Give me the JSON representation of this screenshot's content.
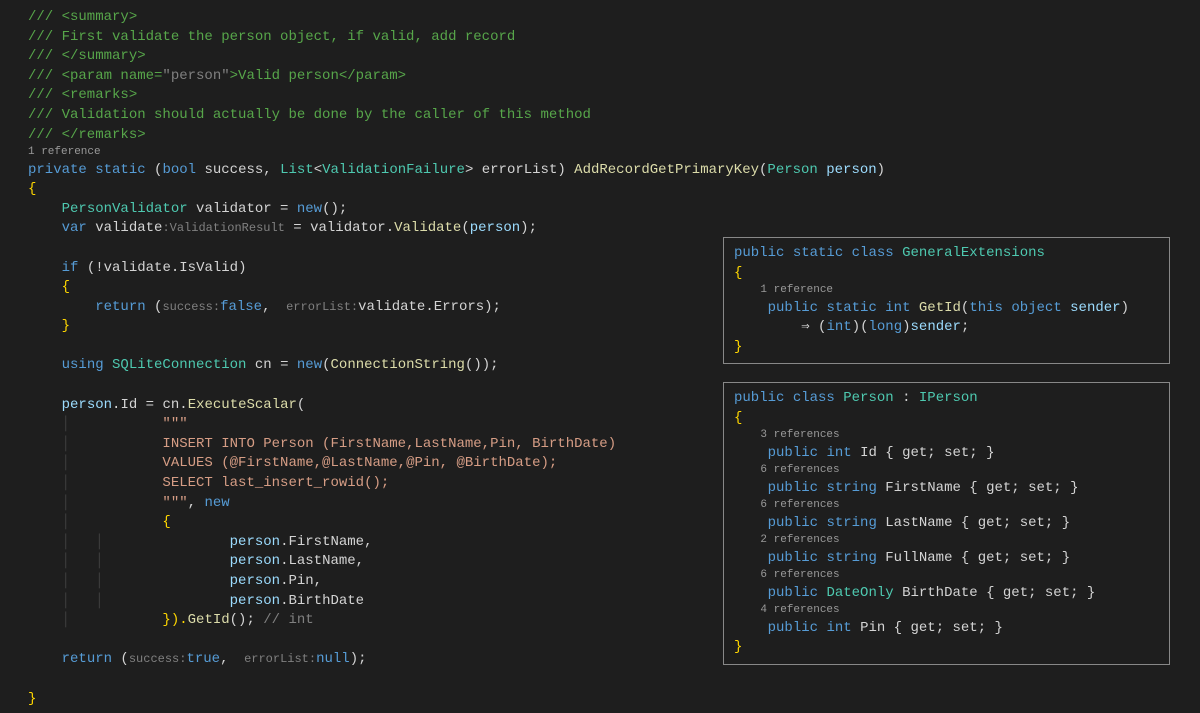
{
  "main": {
    "doc1": "/// <summary>",
    "doc2": "/// First validate the person object, if valid, add record",
    "doc3": "/// </summary>",
    "doc4a": "/// <param name=",
    "doc4b": "\"person\"",
    "doc4c": ">Valid person</param>",
    "doc5": "/// <remarks>",
    "doc6": "/// Validation should actually be done by the caller of this method",
    "doc7": "/// </remarks>",
    "lens1": "1 reference",
    "sig": {
      "private": "private",
      "static": "static",
      "lp": " (",
      "bool": "bool",
      "success": " success",
      "comma": ", ",
      "list": "List",
      "lt": "<",
      "vfail": "ValidationFailure",
      "gt": ">",
      "errorList": " errorList",
      "rp": ") ",
      "methodName": "AddRecordGetPrimaryKey",
      "lp2": "(",
      "personType": "Person",
      "personParam": " person",
      "rp2": ")"
    },
    "openBrace": "{",
    "l1": {
      "indent": "    ",
      "type": "PersonValidator",
      "var": " validator",
      "eq": " = ",
      "new": "new",
      "call": "();"
    },
    "l2": {
      "indent": "    ",
      "var": "var",
      "name": " validate",
      "hint": ":ValidationResult",
      "eq": " = ",
      "obj": "validator",
      "dot": ".",
      "method": "Validate",
      "lp": "(",
      "arg": "person",
      "rp": ");"
    },
    "l3": {
      "indent": "    ",
      "if": "if",
      "lp": " (!",
      "obj": "validate",
      "dot": ".",
      "prop": "IsValid",
      "rp": ")"
    },
    "l4open": "    {",
    "l5": {
      "indent": "        ",
      "return": "return",
      "lp": " (",
      "h1": "success:",
      "v1": "false",
      "comma": ", ",
      "h2": " errorList:",
      "obj": "validate",
      "dot": ".",
      "prop": "Errors",
      "rp": ");"
    },
    "l6close": "    }",
    "l7": {
      "indent": "    ",
      "using": "using",
      "type": " SQLiteConnection",
      "name": " cn",
      "eq": " = ",
      "new": "new",
      "lp": "(",
      "method": "ConnectionString",
      "rp": "());"
    },
    "l8": {
      "indent": "    ",
      "obj": "person",
      "dot": ".",
      "prop": "Id",
      "eq": " = ",
      "cn": "cn",
      "dot2": ".",
      "method": "ExecuteScalar",
      "lp": "("
    },
    "l9": "        \"\"\"",
    "sql1": "        INSERT INTO Person (FirstName,LastName,Pin, BirthDate)",
    "sql2": "        VALUES (@FirstName,@LastName,@Pin, @BirthDate);",
    "sql3": "        SELECT last_insert_rowid();",
    "l13a": "        \"\"\"",
    "l13b": ", ",
    "l13c": "new",
    "l14": "        {",
    "p1a": "            person",
    "p1b": ".FirstName,",
    "p2a": "            person",
    "p2b": ".LastName,",
    "p3a": "            person",
    "p3b": ".Pin,",
    "p4a": "            person",
    "p4b": ".BirthDate",
    "l19a": "        }).",
    "l19b": "GetId",
    "l19c": "();",
    "l19d": " // int",
    "l20": {
      "indent": "    ",
      "return": "return",
      "lp": " (",
      "h1": "success:",
      "v1": "true",
      "comma": ", ",
      "h2": " errorList:",
      "v2": "null",
      "rp": ");"
    },
    "closeBrace": "}"
  },
  "box1": {
    "sig": {
      "public": "public",
      "static": "static",
      "class": "class",
      "name": "GeneralExtensions"
    },
    "open": "{",
    "lens": "1 reference",
    "m": {
      "indent": "    ",
      "public": "public",
      "static": "static",
      "int": "int",
      "name": "GetId",
      "lp": "(",
      "this": "this",
      "object": "object",
      "param": "sender",
      "rp": ")"
    },
    "body": {
      "indent": "        ",
      "arrow": "⇒",
      "lp": " (",
      "int": "int",
      "rp": ")(",
      "long": "long",
      "rp2": ")",
      "sender": "sender",
      "semi": ";"
    },
    "close": "}"
  },
  "box2": {
    "sig": {
      "public": "public",
      "class": "class",
      "name": "Person",
      "colon": " : ",
      "iface": "IPerson"
    },
    "open": "{",
    "refs1": "3 references",
    "p1": {
      "public": "public",
      "type": "int",
      "name": "Id",
      "gs": " { get; set; }"
    },
    "refs2": "6 references",
    "p2": {
      "public": "public",
      "type": "string",
      "name": "FirstName",
      "gs": " { get; set; }"
    },
    "refs3": "6 references",
    "p3": {
      "public": "public",
      "type": "string",
      "name": "LastName",
      "gs": " { get; set; }"
    },
    "refs4": "2 references",
    "p4": {
      "public": "public",
      "type": "string",
      "name": "FullName",
      "gs": " { get; set; }"
    },
    "refs5": "6 references",
    "p5": {
      "public": "public",
      "type": "DateOnly",
      "name": "BirthDate",
      "gs": " { get; set; }"
    },
    "refs6": "4 references",
    "p6": {
      "public": "public",
      "type": "int",
      "name": "Pin",
      "gs": " { get; set; }"
    },
    "close": "}"
  }
}
